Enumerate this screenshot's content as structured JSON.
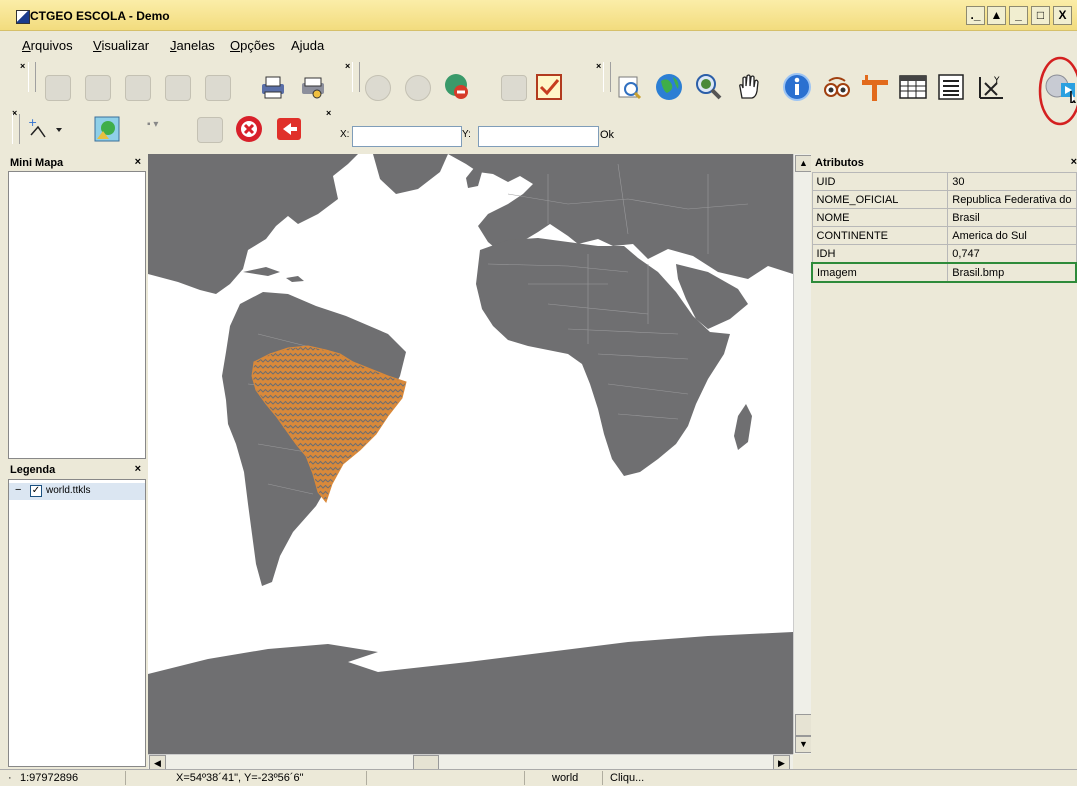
{
  "window": {
    "title": "CTGEO ESCOLA - Demo",
    "controls": [
      "._",
      "▲",
      "_",
      "□",
      "X"
    ]
  },
  "menu": [
    {
      "u": "A",
      "rest": "rquivos"
    },
    {
      "u": "V",
      "rest": "isualizar"
    },
    {
      "u": "J",
      "rest": "anelas"
    },
    {
      "u": "O",
      "rest": "pções"
    },
    {
      "u": "",
      "rest": "Ajuda"
    }
  ],
  "coords": {
    "x_label": "X:",
    "y_label": "Y:",
    "x_value": "",
    "y_value": "",
    "ok_label": "Ok"
  },
  "panels": {
    "minimap_title": "Mini Mapa",
    "legend_title": "Legenda",
    "legend_layer": "world.ttkls",
    "legend_expander": "−",
    "attributes_title": "Atributos"
  },
  "attributes": [
    {
      "key": "UID",
      "value": "30"
    },
    {
      "key": "NOME_OFICIAL",
      "value": "Republica Federativa do"
    },
    {
      "key": "NOME",
      "value": "Brasil"
    },
    {
      "key": "CONTINENTE",
      "value": "America do Sul"
    },
    {
      "key": "IDH",
      "value": "0,747"
    },
    {
      "key": "Imagem",
      "value": "Brasil.bmp"
    }
  ],
  "status": {
    "scale": "1:97972896",
    "coords": "X=54º38´41\", Y=-23º56´6\"",
    "layer": "world",
    "hint": "Cliqu..."
  },
  "colors": {
    "ocean": "#ffffff",
    "land": "#6f6f71",
    "selected": "#d9893a",
    "title_bg": "#f6e396",
    "highlight_circle": "#d42020",
    "highlight_row": "#2e8b3a"
  }
}
